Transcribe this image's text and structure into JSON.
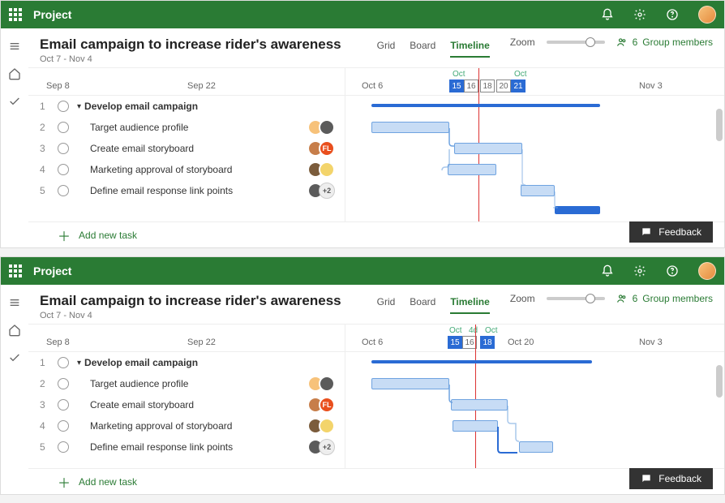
{
  "app_name": "Project",
  "project": {
    "title": "Email campaign to increase rider's awareness",
    "subtitle": "Oct 7 - Nov 4"
  },
  "views": {
    "grid": "Grid",
    "board": "Board",
    "timeline": "Timeline"
  },
  "zoom_label": "Zoom",
  "members": {
    "count": "6",
    "label": "Group members"
  },
  "dates": {
    "sep8": "Sep 8",
    "sep22": "Sep 22",
    "oct6": "Oct 6",
    "oct20": "Oct 20",
    "nov3": "Nov 3",
    "oct": "Oct",
    "d4": "4d"
  },
  "range1": {
    "d15": "15",
    "d16": "16",
    "d18": "18",
    "d20": "20",
    "d21": "21"
  },
  "range2": {
    "d15": "15",
    "d16": "16",
    "d18": "18"
  },
  "tasks": [
    {
      "n": "1",
      "name": "Develop email campaign",
      "bold": true
    },
    {
      "n": "2",
      "name": "Target audience profile"
    },
    {
      "n": "3",
      "name": "Create email storyboard"
    },
    {
      "n": "4",
      "name": "Marketing approval of storyboard"
    },
    {
      "n": "5",
      "name": "Define email response link points"
    }
  ],
  "add_task": "Add new task",
  "feedback": "Feedback",
  "more_avatar": "+2"
}
